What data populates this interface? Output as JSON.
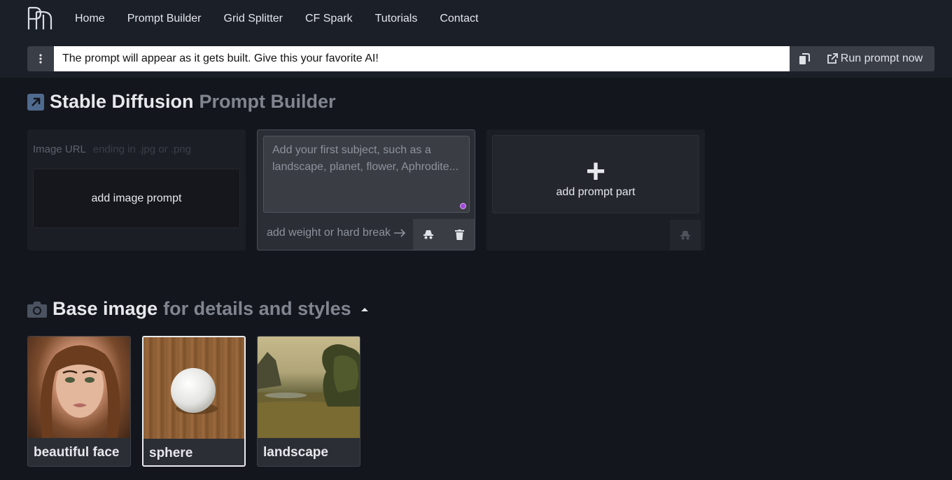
{
  "nav": {
    "items": [
      "Home",
      "Prompt Builder",
      "Grid Splitter",
      "CF Spark",
      "Tutorials",
      "Contact"
    ]
  },
  "prompt_bar": {
    "text": "The prompt will appear as it gets built. Give this your favorite AI!",
    "run_label": "Run prompt now"
  },
  "builder": {
    "title_strong": "Stable Diffusion",
    "title_muted": "Prompt Builder",
    "image_url_label": "Image URL",
    "image_url_placeholder": "ending in .jpg or .png",
    "add_image_label": "add image prompt",
    "subject_placeholder": "Add your first subject, such as a landscape, planet, flower, Aphrodite...",
    "weight_label": "add weight or hard break",
    "add_part_label": "add prompt part"
  },
  "base_image": {
    "title_strong": "Base image",
    "title_muted": "for details and styles",
    "items": [
      {
        "label": "beautiful face",
        "selected": false
      },
      {
        "label": "sphere",
        "selected": true
      },
      {
        "label": "landscape",
        "selected": false
      }
    ]
  },
  "colors": {
    "page_bg": "#13161c",
    "topbar_bg": "#1b1f27",
    "accent_dot": "#a24bd8"
  }
}
